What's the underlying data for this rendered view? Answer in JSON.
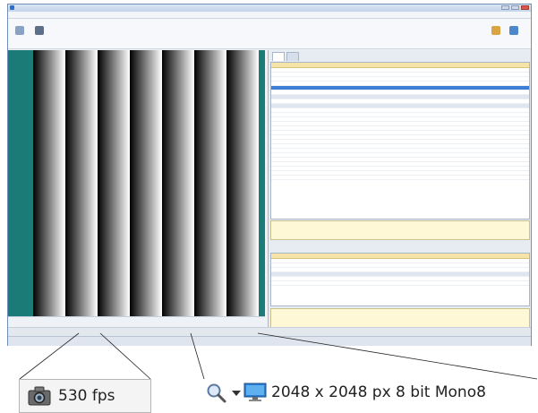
{
  "fps_label": "530 fps",
  "image_info": "2048 x 2048 px 8 bit Mono8",
  "colors": {
    "viewer_bg": "#1b7c77",
    "highlight": "#f6e3a8",
    "accent": "#3d7fd6"
  },
  "icons": {
    "fps": "camera-icon",
    "zoom": "magnifier-icon",
    "dropdown": "chevron-down-icon",
    "image": "monitor-icon"
  }
}
